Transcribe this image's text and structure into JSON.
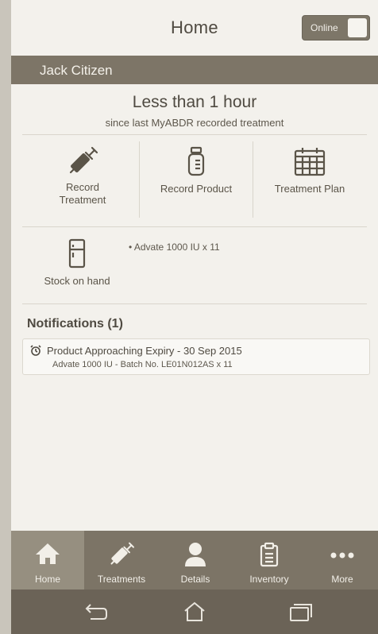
{
  "header": {
    "title": "Home",
    "online_label": "Online"
  },
  "user": {
    "name": "Jack Citizen"
  },
  "summary": {
    "headline": "Less than 1 hour",
    "subline": "since last MyABDR recorded treatment"
  },
  "actions": [
    {
      "label_line1": "Record",
      "label_line2": "Treatment",
      "icon": "syringe-icon"
    },
    {
      "label_line1": "Record Product",
      "label_line2": "",
      "icon": "vial-icon"
    },
    {
      "label_line1": "Treatment Plan",
      "label_line2": "",
      "icon": "calendar-icon"
    }
  ],
  "stock": {
    "label": "Stock on hand",
    "icon": "fridge-icon",
    "items": [
      "• Advate 1000 IU x 11"
    ]
  },
  "notifications": {
    "title": "Notifications (1)",
    "items": [
      {
        "icon": "alarm-clock-icon",
        "title": "Product Approaching Expiry - 30 Sep 2015",
        "detail": "Advate 1000 IU - Batch No. LE01N012AS x 11"
      }
    ]
  },
  "tabbar": {
    "tabs": [
      {
        "label": "Home",
        "icon": "home-icon",
        "active": true
      },
      {
        "label": "Treatments",
        "icon": "syringe-icon",
        "active": false
      },
      {
        "label": "Details",
        "icon": "person-icon",
        "active": false
      },
      {
        "label": "Inventory",
        "icon": "clipboard-icon",
        "active": false
      },
      {
        "label": "More",
        "icon": "ellipsis-icon",
        "active": false
      }
    ]
  },
  "navbar": {
    "buttons": [
      "back-icon",
      "home-icon",
      "recents-icon"
    ]
  },
  "colors": {
    "background": "#f3f1ec",
    "accent_bar": "#7d7567",
    "tabbar": "#7c7466",
    "tab_active": "#968f80",
    "text": "#4f4a41"
  }
}
